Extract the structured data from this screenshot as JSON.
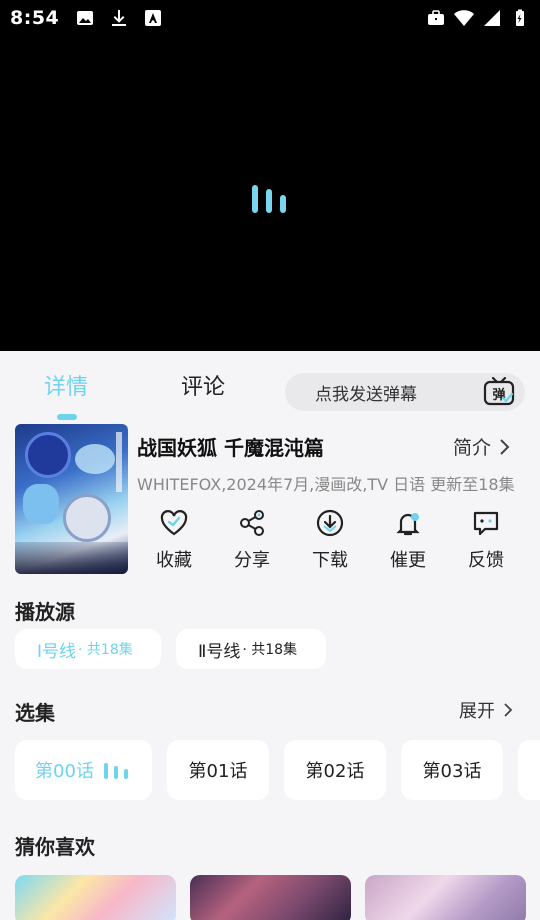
{
  "status_bar": {
    "time": "8:54",
    "left_icons": [
      "image-icon",
      "download-icon",
      "font-a-icon"
    ],
    "right_icons": [
      "briefcase-icon",
      "wifi-icon",
      "signal-icon",
      "battery-charging-icon"
    ]
  },
  "player": {
    "state": "loading",
    "accent_color": "#6fd3ee"
  },
  "tabs": {
    "details": "详情",
    "comments": "评论",
    "active": "details"
  },
  "danmaku": {
    "placeholder": "点我发送弹幕",
    "icon_label": "弹"
  },
  "anime": {
    "title": "战国妖狐 千魔混沌篇",
    "intro_label": "简介",
    "meta": "WHITEFOX,2024年7月,漫画改,TV 日语 更新至18集"
  },
  "actions": [
    {
      "label": "收藏",
      "icon": "heart-icon"
    },
    {
      "label": "分享",
      "icon": "share-icon"
    },
    {
      "label": "下载",
      "icon": "download-circle-icon"
    },
    {
      "label": "催更",
      "icon": "bell-icon"
    },
    {
      "label": "反馈",
      "icon": "feedback-icon"
    }
  ],
  "sources": {
    "title": "播放源",
    "items": [
      {
        "name": "Ⅰ号线",
        "count": "· 共18集",
        "active": true
      },
      {
        "name": "Ⅱ号线",
        "count": "· 共18集",
        "active": false
      }
    ]
  },
  "episodes": {
    "title": "选集",
    "expand_label": "展开",
    "items": [
      {
        "label": "第00话",
        "active": true
      },
      {
        "label": "第01话",
        "active": false
      },
      {
        "label": "第02话",
        "active": false
      },
      {
        "label": "第03话",
        "active": false
      }
    ]
  },
  "recommend": {
    "title": "猜你喜欢"
  }
}
